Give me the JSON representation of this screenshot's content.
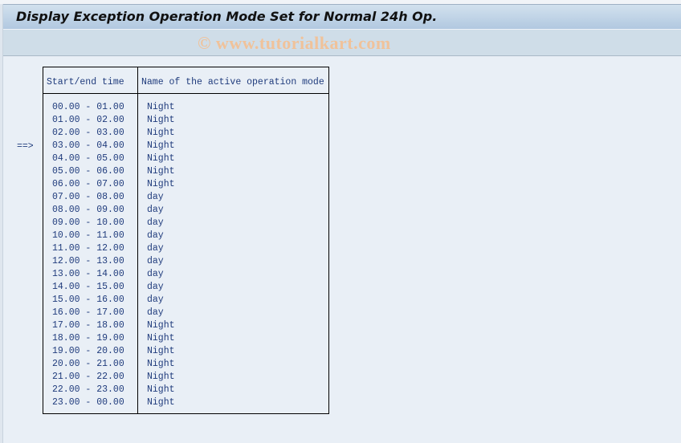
{
  "window": {
    "title": "Display Exception Operation Mode Set for Normal 24h Op.",
    "watermark": "© www.tutorialkart.com"
  },
  "table": {
    "headers": [
      "Start/end time",
      "Name of the active operation mode"
    ],
    "current_marker": "==>",
    "current_row_index": 3,
    "rows": [
      {
        "time": "00.00 - 01.00",
        "mode": "Night"
      },
      {
        "time": "01.00 - 02.00",
        "mode": "Night"
      },
      {
        "time": "02.00 - 03.00",
        "mode": "Night"
      },
      {
        "time": "03.00 - 04.00",
        "mode": "Night"
      },
      {
        "time": "04.00 - 05.00",
        "mode": "Night"
      },
      {
        "time": "05.00 - 06.00",
        "mode": "Night"
      },
      {
        "time": "06.00 - 07.00",
        "mode": "Night"
      },
      {
        "time": "07.00 - 08.00",
        "mode": "day"
      },
      {
        "time": "08.00 - 09.00",
        "mode": "day"
      },
      {
        "time": "09.00 - 10.00",
        "mode": "day"
      },
      {
        "time": "10.00 - 11.00",
        "mode": "day"
      },
      {
        "time": "11.00 - 12.00",
        "mode": "day"
      },
      {
        "time": "12.00 - 13.00",
        "mode": "day"
      },
      {
        "time": "13.00 - 14.00",
        "mode": "day"
      },
      {
        "time": "14.00 - 15.00",
        "mode": "day"
      },
      {
        "time": "15.00 - 16.00",
        "mode": "day"
      },
      {
        "time": "16.00 - 17.00",
        "mode": "day"
      },
      {
        "time": "17.00 - 18.00",
        "mode": "Night"
      },
      {
        "time": "18.00 - 19.00",
        "mode": "Night"
      },
      {
        "time": "19.00 - 20.00",
        "mode": "Night"
      },
      {
        "time": "20.00 - 21.00",
        "mode": "Night"
      },
      {
        "time": "21.00 - 22.00",
        "mode": "Night"
      },
      {
        "time": "22.00 - 23.00",
        "mode": "Night"
      },
      {
        "time": "23.00 - 00.00",
        "mode": "Night"
      }
    ]
  }
}
